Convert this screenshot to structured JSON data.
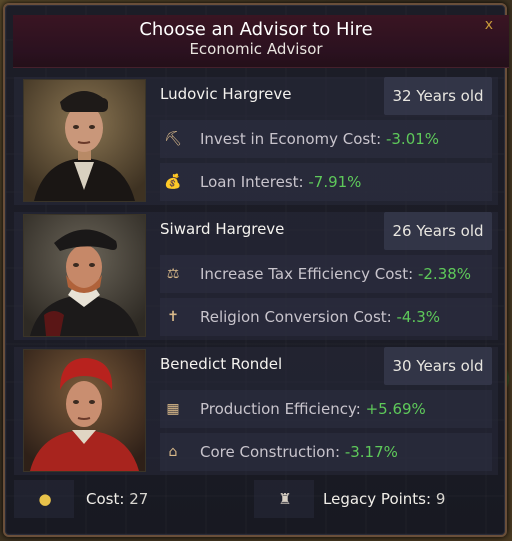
{
  "dialog": {
    "title": "Choose an Advisor to Hire",
    "subtitle": "Economic Advisor",
    "close_label": "x"
  },
  "advisors": [
    {
      "name": "Ludovic Hargreve",
      "age": "32 Years old",
      "stats": [
        {
          "icon": "invest-economy-icon",
          "glyph": "⛏",
          "label": "Invest in Economy Cost:",
          "value": "-3.01%"
        },
        {
          "icon": "loan-interest-icon",
          "glyph": "💰",
          "label": "Loan Interest:",
          "value": "-7.91%"
        }
      ]
    },
    {
      "name": "Siward Hargreve",
      "age": "26 Years old",
      "stats": [
        {
          "icon": "tax-efficiency-icon",
          "glyph": "⚖",
          "label": "Increase Tax Efficiency Cost:",
          "value": "-2.38%"
        },
        {
          "icon": "religion-conversion-icon",
          "glyph": "✝",
          "label": "Religion Conversion Cost:",
          "value": "-4.3%"
        }
      ]
    },
    {
      "name": "Benedict Rondel",
      "age": "30 Years old",
      "stats": [
        {
          "icon": "production-efficiency-icon",
          "glyph": "▦",
          "label": "Production Efficiency:",
          "value": "+5.69%"
        },
        {
          "icon": "core-construction-icon",
          "glyph": "⌂",
          "label": "Core Construction:",
          "value": "-3.17%"
        }
      ]
    }
  ],
  "footer": {
    "cost_label": "Cost:",
    "cost_value": "27",
    "legacy_label": "Legacy Points:",
    "legacy_value": "9"
  },
  "colors": {
    "header_bg": "#2b1120",
    "panel_bg": "#1c1d27",
    "positive": "#5ec95a",
    "close": "#c89a3a"
  }
}
